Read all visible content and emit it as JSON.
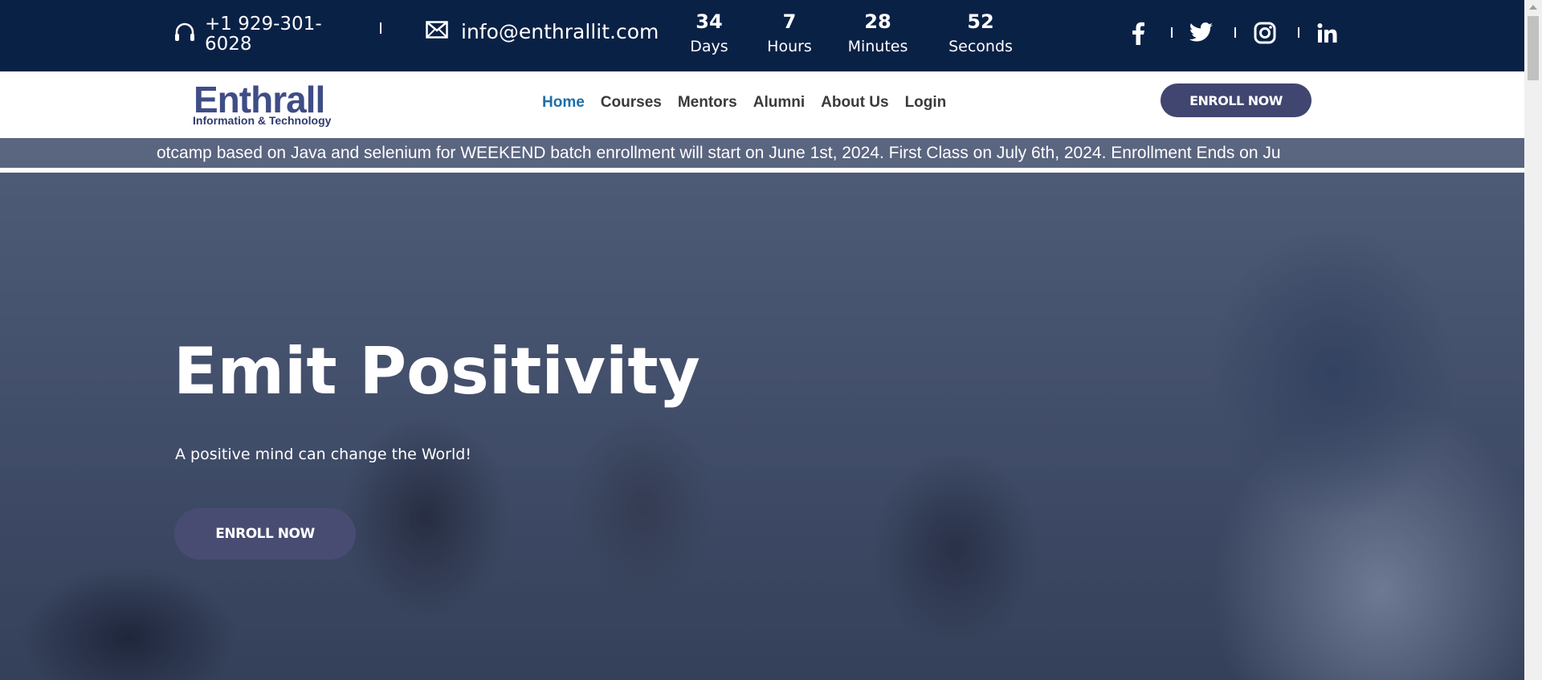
{
  "topbar": {
    "phone": "+1 929-301-6028",
    "email": "info@enthrallit.com",
    "countdown": [
      {
        "value": "34",
        "unit": "Days"
      },
      {
        "value": "7",
        "unit": "Hours"
      },
      {
        "value": "28",
        "unit": "Minutes"
      },
      {
        "value": "52",
        "unit": "Seconds"
      }
    ],
    "social": [
      "facebook-icon",
      "twitter-icon",
      "instagram-icon",
      "linkedin-icon"
    ]
  },
  "logo": {
    "name": "Enthrall",
    "tagline": "Information & Technology"
  },
  "nav": {
    "items": [
      "Home",
      "Courses",
      "Mentors",
      "Alumni",
      "About Us",
      "Login"
    ],
    "active": "Home",
    "enroll_label": "ENROLL NOW"
  },
  "ticker": {
    "message": "otcamp based on Java and selenium for WEEKEND batch enrollment will start on June 1st, 2024. First Class on July 6th, 2024. Enrollment Ends on Ju"
  },
  "hero": {
    "title": "Emit Positivity",
    "subtitle": "A positive mind can change the World!",
    "enroll_label": "ENROLL NOW"
  },
  "colors": {
    "topbar_bg": "#0a2146",
    "nav_active": "#1d6fa8",
    "button_bg": "#40466f",
    "ticker_bg": "#5a6580"
  }
}
